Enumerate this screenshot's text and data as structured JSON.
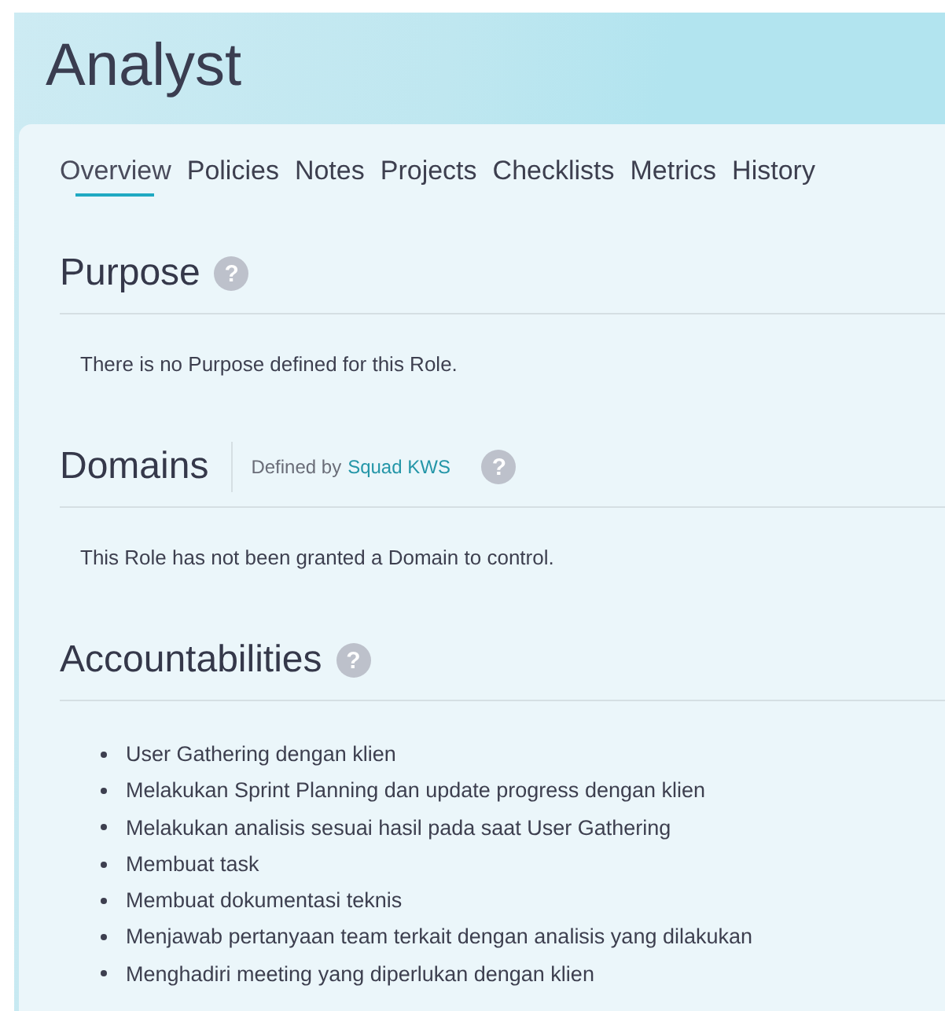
{
  "header": {
    "title": "Analyst"
  },
  "tabs": [
    {
      "label": "Overview",
      "selected": true
    },
    {
      "label": "Policies",
      "selected": false
    },
    {
      "label": "Notes",
      "selected": false
    },
    {
      "label": "Projects",
      "selected": false
    },
    {
      "label": "Checklists",
      "selected": false
    },
    {
      "label": "Metrics",
      "selected": false
    },
    {
      "label": "History",
      "selected": false
    }
  ],
  "purpose": {
    "heading": "Purpose",
    "help": "?",
    "text": "There is no Purpose defined for this Role."
  },
  "domains": {
    "heading": "Domains",
    "help": "?",
    "defined_by": "Defined by",
    "defined_by_link": "Squad KWS",
    "text": "This Role has not been granted a Domain to control."
  },
  "accountabilities": {
    "heading": "Accountabilities",
    "help": "?",
    "items": [
      "User Gathering dengan klien",
      "Melakukan Sprint Planning dan update progress dengan klien",
      "Melakukan analisis sesuai hasil pada saat User Gathering",
      "Membuat task",
      "Membuat dokumentasi teknis",
      "Menjawab pertanyaan team terkait dengan analisis yang dilakukan",
      "Menghadiri meeting yang diperlukan dengan klien"
    ]
  }
}
